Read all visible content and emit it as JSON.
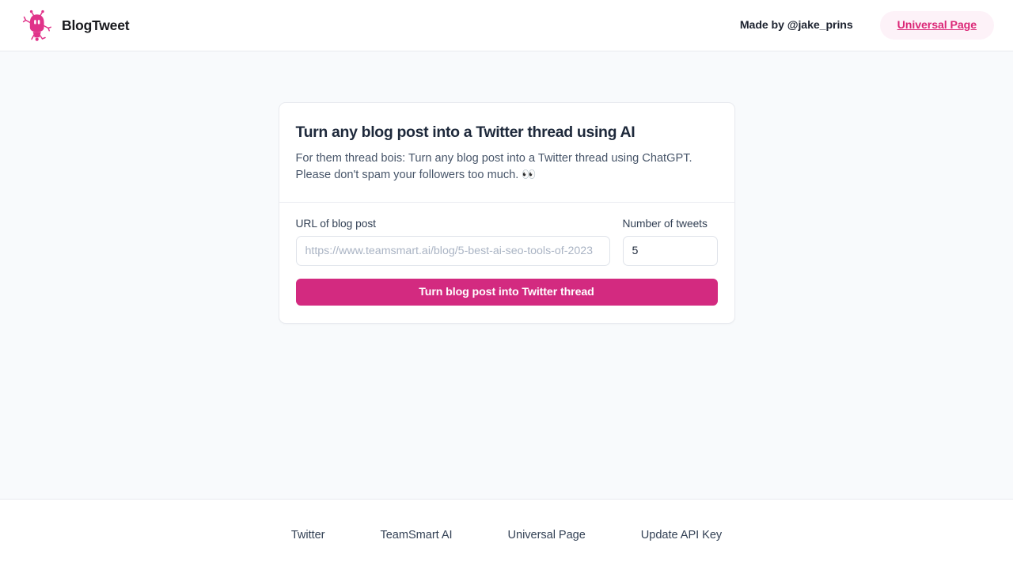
{
  "header": {
    "logo_icon": "robot-mascot-icon",
    "brand_name": "BlogTweet",
    "made_by": "Made by @jake_prins",
    "badge_label": "Universal Page"
  },
  "card": {
    "title": "Turn any blog post into a Twitter thread using AI",
    "description": "For them thread bois: Turn any blog post into a Twitter thread using ChatGPT. Please don't spam your followers too much. 👀",
    "url_field": {
      "label": "URL of blog post",
      "value": "",
      "placeholder": "https://www.teamsmart.ai/blog/5-best-ai-seo-tools-of-2023"
    },
    "tweets_field": {
      "label": "Number of tweets",
      "value": "5"
    },
    "submit_label": "Turn blog post into Twitter thread"
  },
  "footer": {
    "links": [
      {
        "label": "Twitter"
      },
      {
        "label": "TeamSmart AI"
      },
      {
        "label": "Universal Page"
      },
      {
        "label": "Update API Key"
      }
    ]
  },
  "colors": {
    "accent": "#d32a80",
    "badge_text": "#db2777",
    "badge_bg": "#fdf2f8",
    "page_bg": "#f8fafc",
    "text_primary": "#1e293b",
    "text_secondary": "#475569"
  }
}
